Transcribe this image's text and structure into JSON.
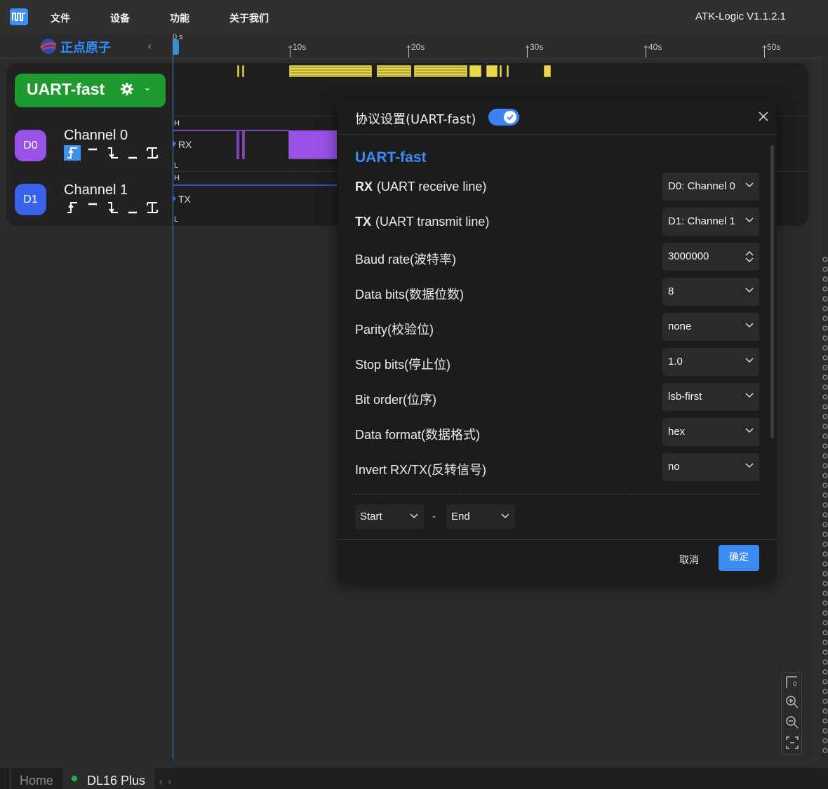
{
  "app": {
    "menu": [
      "文件",
      "设备",
      "功能",
      "关于我们"
    ],
    "version": "ATK-Logic V1.1.2.1",
    "logo_text": "正点原子"
  },
  "ruler": {
    "origin": "0 s",
    "ticks": [
      "+10s",
      "+20s",
      "+30s",
      "+40s",
      "+50s"
    ]
  },
  "decoder": {
    "name": "UART-fast"
  },
  "channels": [
    {
      "badge": "D0",
      "name": "Channel 0",
      "signal": "RX",
      "color": "#9a52e6"
    },
    {
      "badge": "D1",
      "name": "Channel 1",
      "signal": "TX",
      "color": "#3a63ec"
    }
  ],
  "levels": {
    "high": "H",
    "low": "L"
  },
  "dialog": {
    "title": "协议设置(UART-fast)",
    "subtitle": "UART-fast",
    "fields": [
      {
        "key": "RX",
        "label": "(UART receive line)",
        "value": "D0: Channel 0",
        "control": "select"
      },
      {
        "key": "TX",
        "label": "(UART transmit line)",
        "value": "D1: Channel 1",
        "control": "select"
      },
      {
        "key": "",
        "label": "Baud rate(波特率)",
        "value": "3000000",
        "control": "spin"
      },
      {
        "key": "",
        "label": "Data bits(数据位数)",
        "value": "8",
        "control": "select"
      },
      {
        "key": "",
        "label": "Parity(校验位)",
        "value": "none",
        "control": "select"
      },
      {
        "key": "",
        "label": "Stop bits(停止位)",
        "value": "1.0",
        "control": "select"
      },
      {
        "key": "",
        "label": "Bit order(位序)",
        "value": "lsb-first",
        "control": "select"
      },
      {
        "key": "",
        "label": "Data format(数据格式)",
        "value": "hex",
        "control": "select"
      },
      {
        "key": "",
        "label": "Invert RX/TX(反转信号)",
        "value": "no",
        "control": "select"
      }
    ],
    "range": {
      "start": "Start",
      "separator": "-",
      "end": "End"
    },
    "cancel": "取消",
    "ok": "确定"
  },
  "bottom": {
    "home_tab": "Home",
    "device_tab": "DL16 Plus"
  },
  "colors": {
    "accent": "#3b8bf5",
    "decoder_green": "#1e9b2e",
    "decode_marks": "#e8d84a"
  }
}
